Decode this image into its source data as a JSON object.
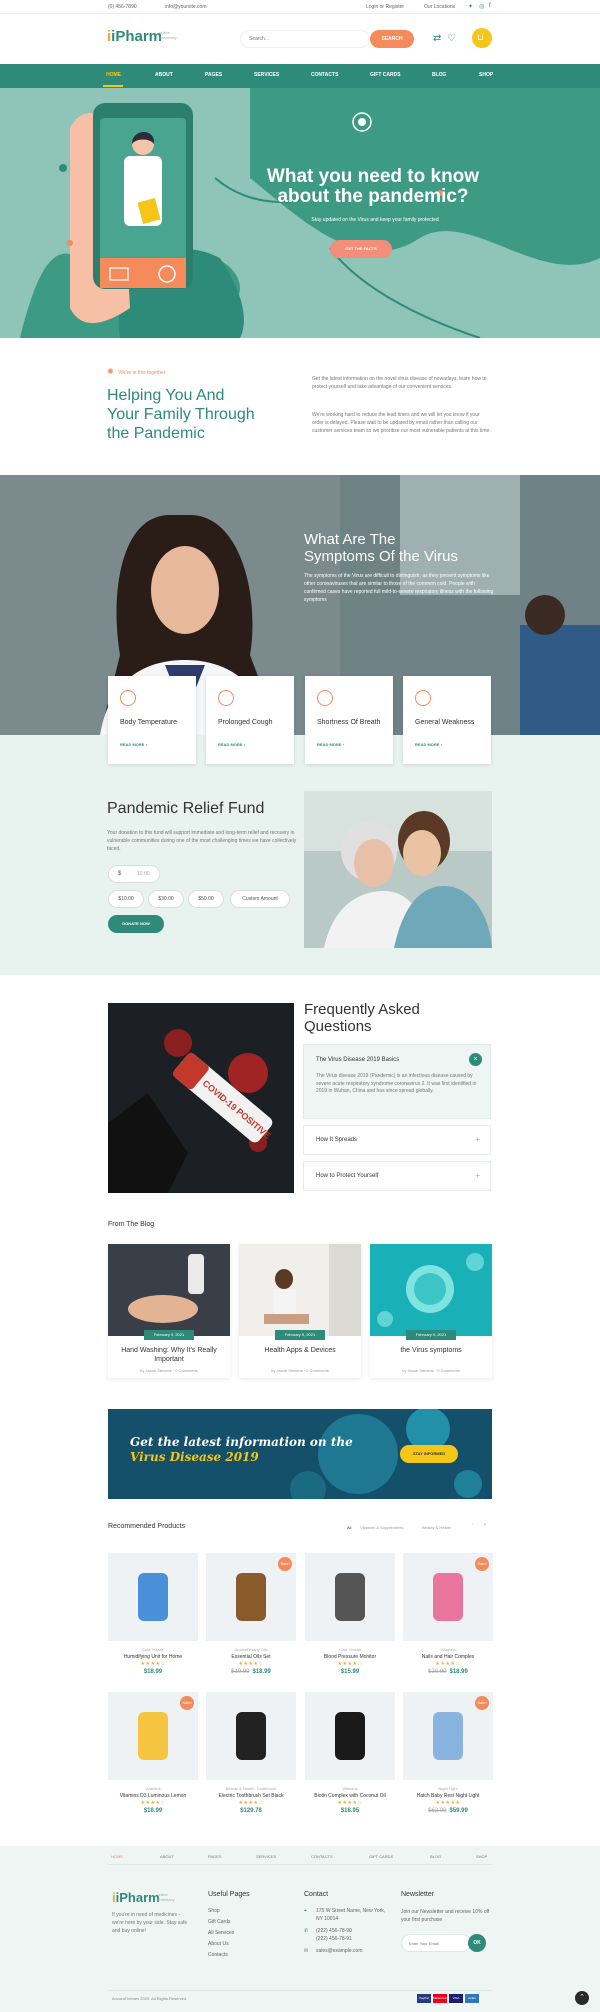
{
  "topbar": {
    "phone": "(0) 456-7890",
    "email": "info@yoursite.com",
    "login": "Login or Register",
    "locations": "Our Locations"
  },
  "brand": {
    "logo": "iPharm",
    "tagline": "online pharmacy"
  },
  "search": {
    "placeholder": "Search...",
    "button": "SEARCH"
  },
  "cart": {
    "wishlist_count": "0",
    "cart_count": "0"
  },
  "nav": {
    "items": [
      "HOME",
      "ABOUT",
      "PAGES",
      "SERVICES",
      "CONTACTS",
      "GIFT CARDS",
      "BLOG",
      "SHOP"
    ]
  },
  "hero": {
    "title_line1": "What you need to know",
    "title_line2": "about the pandemic?",
    "subtitle": "Stay updated on the Virus and keep your family protected",
    "button": "GET THE FACTS"
  },
  "intro": {
    "tag": "We're in this together",
    "heading_line1": "Helping You And",
    "heading_line2": "Your Family Through",
    "heading_line3": "the Pandemic",
    "para1": "Get the latest information on the novel virus disease of nowadays, learn how to protect yourself and take advantage of our convenient services.",
    "para2": "We're working hard to reduce the lead times and we will let you know if your order is delayed. Please wait to be updated by email rather than calling our customer services team so we prioritise our most vulnerable patients at this time."
  },
  "symptoms": {
    "heading_line1": "What Are The",
    "heading_line2": "Symptoms Of the Virus",
    "text": "The symptoms of the Virus are difficult to distinguish, as they present symptoms like other coronaviruses that are similar to those of the common cold. People with confirmed cases have reported full mild-to-severe respiratory illness with the following symptoms",
    "cards": [
      {
        "title": "Body Temperature",
        "link": "READ MORE"
      },
      {
        "title": "Prolonged Cough",
        "link": "READ MORE"
      },
      {
        "title": "Shortness Of Breath",
        "link": "READ MORE"
      },
      {
        "title": "General Weakness",
        "link": "READ MORE"
      }
    ]
  },
  "relief": {
    "heading": "Pandemic Relief Fund",
    "text": "Your donation to this fund will support immediate and long-term relief and recovery in vulnerable communities during one of the most challenging times we have collectively faced.",
    "currency": "$",
    "amount_value": "10.00",
    "amounts": [
      "$10.00",
      "$30.00",
      "$50.00",
      "Custom Amount"
    ],
    "donate": "DONATE NOW"
  },
  "faq": {
    "heading_line1": "Frequently Asked",
    "heading_line2": "Questions",
    "open_title": "The Virus Disease 2019 Basics",
    "open_text": "The Virus disease 2019 (Pandemic) is an infectious disease caused by severe acute respiratory syndrome coronavirus 2. It was first identified in 2019 in Wuhan, China and has since spread globally.",
    "items": [
      "How It Spreads",
      "How to Protect Yourself"
    ],
    "image_text": "COVID-19 POSITIVE"
  },
  "blog": {
    "heading": "From The Blog",
    "posts": [
      {
        "date": "February 9, 2021",
        "title_line1": "Hand Washing: Why It's Really",
        "title_line2": "Important",
        "meta": "by Jacob Stevens · 0 Comments"
      },
      {
        "date": "February 9, 2021",
        "title_line1": "Health Apps & Devices",
        "title_line2": "",
        "meta": "by Jacob Stevens · 0 Comments"
      },
      {
        "date": "February 9, 2021",
        "title_line1": "the Virus symptoms",
        "title_line2": "",
        "meta": "by Jacob Stevens · 0 Comments"
      }
    ]
  },
  "banner": {
    "line1": "Get the latest information on the",
    "line2": "Virus Disease 2019",
    "button": "STAY INFORMED"
  },
  "products": {
    "heading": "Recommended Products",
    "filters": [
      "All",
      "Vitamins & Supplements",
      "Beauty & Health"
    ],
    "sale_label": "Sale!",
    "items": [
      {
        "cat": "Cold, Health",
        "name": "Humidifying Unit for Home",
        "stars": "★★★★☆",
        "price": "$18.99",
        "old": "",
        "sale": false,
        "color": "#4a90d9"
      },
      {
        "cat": "Aromatherapy Oils",
        "name": "Essential Oils Set",
        "stars": "★★★★☆",
        "price": "$18.99",
        "old": "$19.99",
        "sale": true,
        "color": "#8b5a2b"
      },
      {
        "cat": "Cold, Health",
        "name": "Blood Pressure Monitor",
        "stars": "★★★★☆",
        "price": "$15.99",
        "old": "",
        "sale": false,
        "color": "#555555"
      },
      {
        "cat": "Vitamins",
        "name": "Nails and Hair Complex",
        "stars": "★★★★☆",
        "price": "$18.99",
        "old": "$36.99",
        "sale": true,
        "color": "#e8769c"
      },
      {
        "cat": "Vitamins",
        "name": "Vitamins D3 Luminous Lemon",
        "stars": "★★★★☆",
        "price": "$18.99",
        "old": "",
        "sale": true,
        "color": "#f5c542"
      },
      {
        "cat": "Beauty & Health, Toothbrush",
        "name": "Electric Toothbrush Set Black",
        "stars": "★★★★☆",
        "price": "$129.78",
        "old": "",
        "sale": false,
        "color": "#222222"
      },
      {
        "cat": "Vitamins",
        "name": "Biotin Complex with Coconut Oil",
        "stars": "★★★★☆",
        "price": "$18.95",
        "old": "",
        "sale": false,
        "color": "#1a1a1a"
      },
      {
        "cat": "Night Light",
        "name": "Hatch Baby Rest Night Light",
        "stars": "★★★★★",
        "price": "$59.99",
        "old": "$63.99",
        "sale": true,
        "color": "#8ab4e0"
      }
    ]
  },
  "footer": {
    "nav": [
      "HOME",
      "ABOUT",
      "PAGES",
      "SERVICES",
      "CONTACTS",
      "GIFT CARDS",
      "BLOG",
      "SHOP"
    ],
    "about": "If you're in need of medicines - we're here by your side. Stay safe and buy online!",
    "useful_title": "Useful Pages",
    "useful": [
      "Shop",
      "Gift Cards",
      "All Services",
      "About Us",
      "Contacts"
    ],
    "contact_title": "Contact",
    "address_line1": "175 W Street Name, New York,",
    "address_line2": "NY 10014",
    "phone1": "(222) 456-78-90",
    "phone2": "(222) 456-78-91",
    "email": "sales@example.com",
    "newsletter_title": "Newsletter",
    "newsletter_text": "Join our Newsletter and receive 10% off your first purchase",
    "newsletter_placeholder": "Enter Your Email",
    "newsletter_button": "OK",
    "copyright": "AncoraThemes 2020. All Rights Reserved.",
    "payments": [
      "PayPal",
      "MasterCard",
      "VISA",
      "AmEx"
    ]
  },
  "colors": {
    "primary": "#2e8b7a",
    "accent": "#f58a5a",
    "hero_bg": "#8fc4b8"
  }
}
